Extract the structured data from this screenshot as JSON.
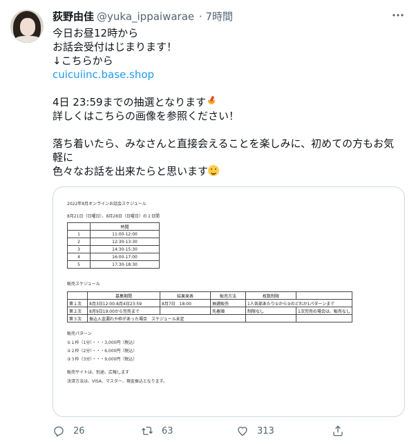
{
  "tweet": {
    "display_name": "荻野由佳",
    "handle": "@yuka_ippaiwarae",
    "time": "· 7時間",
    "lines": [
      "今日お昼12時から",
      "お話会受付はじまります！",
      "↓こちらから"
    ],
    "link": "cuicuiinc.base.shop",
    "line_deadline": "4日 23:59までの抽選となります",
    "line_details": "詳しくはこちらの画像を参照ください！",
    "line_calm_a": "落ち着いたら、みなさんと直接会えることを楽しみに、初めての方もお気",
    "line_calm_b": "軽に",
    "line_talk": "色々なお話を出来たらと思います",
    "emoji_1": "tropical-drink-emoji",
    "emoji_2": "smiling-face-emoji"
  },
  "image": {
    "title": "2022年8月オンラインお話会スケジュール",
    "dates": "8月21日（日曜日）、8月28日（日曜日）の２日間",
    "time_header": "時間",
    "slots": [
      {
        "no": "1",
        "time": "11:00-12:00"
      },
      {
        "no": "2",
        "time": "12:30-13:30"
      },
      {
        "no": "3",
        "time": "14:30-15:30"
      },
      {
        "no": "4",
        "time": "16:00-17:00"
      },
      {
        "no": "5",
        "time": "17:30-18:30"
      }
    ],
    "sales_schedule_label": "販売スケジュール",
    "sales_headers": [
      "",
      "募集期間",
      "結果発表",
      "販売方法",
      "枚数制限",
      ""
    ],
    "sales_rows": [
      [
        "第１次",
        "8月3日12:00-8月4日23:59",
        "8月7日　18:00",
        "抽選販売",
        "1人各部あたり①から③のどれか1パターンまで",
        ""
      ],
      [
        "第２次",
        "8月9日19:00から完売まで",
        "",
        "先着順",
        "制限なし",
        "1次完売の場合は、販売なし"
      ],
      [
        "第３次",
        "振込入金漏れや枠があった場合　スケジュール未定",
        "",
        "",
        "",
        ""
      ]
    ],
    "patterns_label": "販売パターン",
    "patterns": [
      "①１枠（1分）・・・3,000円（税込）",
      "②２枠（2分）・・・6,000円（税込）",
      "③３枠（3分）・・・9,000円（税込）"
    ],
    "note_1": "販売サイトは、別途、広報します",
    "note_2": "決済方法は、VISA、マスター、現金振込となります。"
  },
  "actions": {
    "replies": "26",
    "retweets": "63",
    "likes": "313"
  },
  "colors": {
    "link": "#1d9bf0",
    "secondary": "#536471",
    "border": "#cfd9de"
  }
}
